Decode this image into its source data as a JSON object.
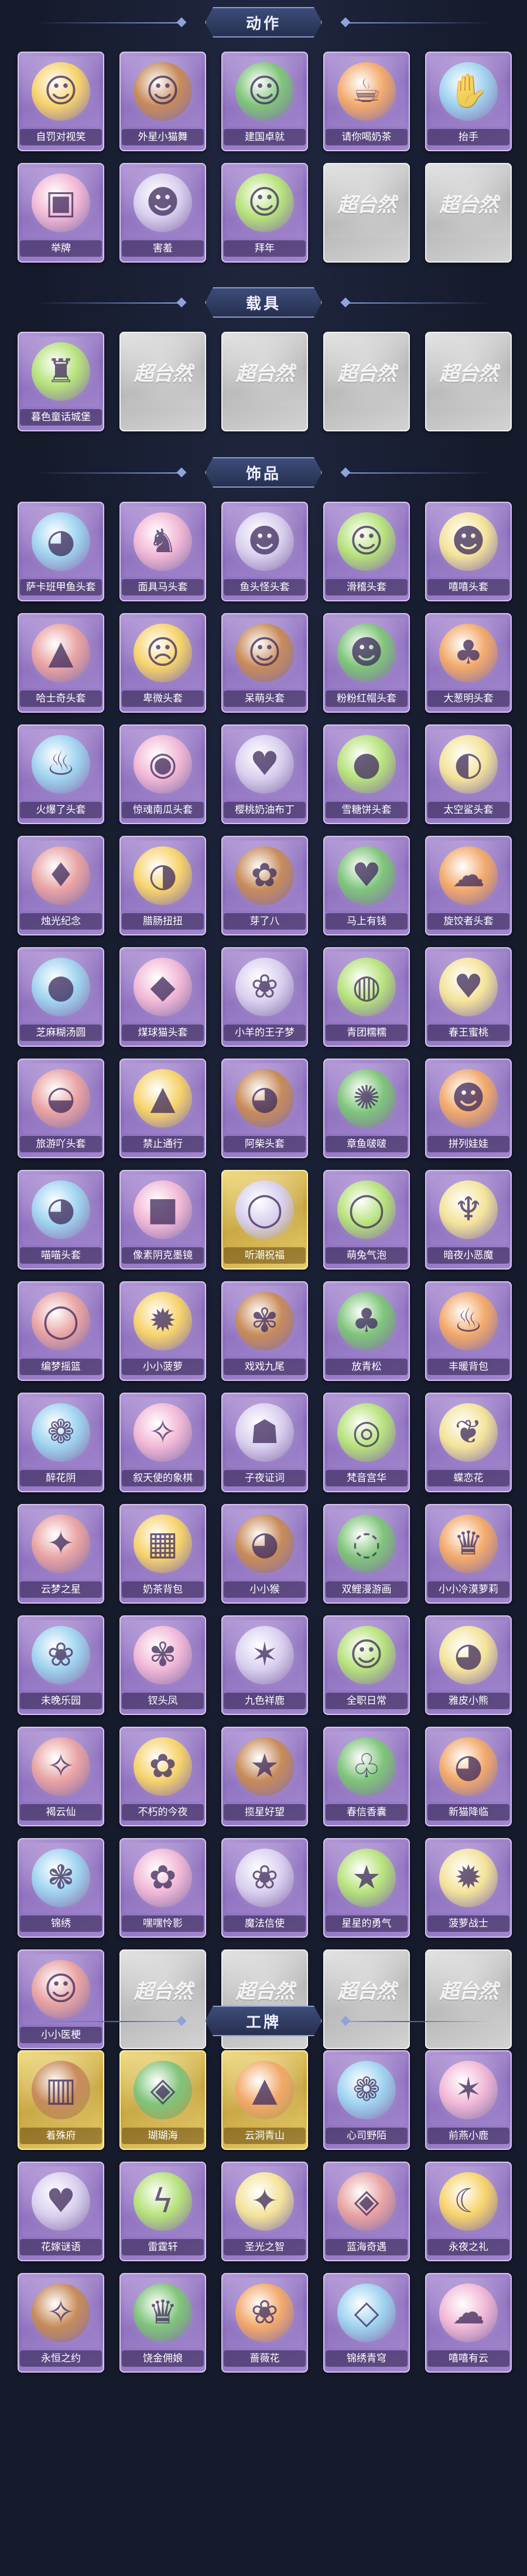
{
  "placeholder_logo": "超台然",
  "sections": [
    {
      "id": "actions",
      "title": "动作",
      "items": [
        {
          "label": "自罚对视笑",
          "icon": "dance-figure-icon",
          "tone": "purple"
        },
        {
          "label": "外星小猫舞",
          "icon": "dance-figure-icon",
          "tone": "purple"
        },
        {
          "label": "建国卓就",
          "icon": "dance-figure-icon",
          "tone": "purple"
        },
        {
          "label": "请你喝奶茶",
          "icon": "milk-tea-icon",
          "tone": "purple"
        },
        {
          "label": "抬手",
          "icon": "raise-hand-icon",
          "tone": "purple"
        },
        {
          "label": "举牌",
          "icon": "sign-board-icon",
          "tone": "purple"
        },
        {
          "label": "害羞",
          "icon": "shy-figure-icon",
          "tone": "purple"
        },
        {
          "label": "拜年",
          "icon": "bow-figure-icon",
          "tone": "purple"
        },
        {
          "label": "",
          "icon": "placeholder-logo-icon",
          "tone": "empty"
        },
        {
          "label": "",
          "icon": "placeholder-logo-icon",
          "tone": "empty"
        }
      ]
    },
    {
      "id": "vehicles",
      "title": "载具",
      "items": [
        {
          "label": "暮色童话城堡",
          "icon": "castle-icon",
          "tone": "purple"
        },
        {
          "label": "",
          "icon": "placeholder-logo-icon",
          "tone": "empty"
        },
        {
          "label": "",
          "icon": "placeholder-logo-icon",
          "tone": "empty"
        },
        {
          "label": "",
          "icon": "placeholder-logo-icon",
          "tone": "empty"
        },
        {
          "label": "",
          "icon": "placeholder-logo-icon",
          "tone": "empty"
        }
      ]
    },
    {
      "id": "accessories",
      "title": "饰品",
      "items": [
        {
          "label": "萨卡班甲鱼头套",
          "icon": "fish-head-icon",
          "tone": "purple"
        },
        {
          "label": "面具马头套",
          "icon": "horse-head-icon",
          "tone": "purple"
        },
        {
          "label": "鱼头怪头套",
          "icon": "fish-monster-icon",
          "tone": "purple"
        },
        {
          "label": "滑稽头套",
          "icon": "smirk-face-icon",
          "tone": "purple"
        },
        {
          "label": "嘻嘻头套",
          "icon": "grin-face-icon",
          "tone": "purple"
        },
        {
          "label": "哈士奇头套",
          "icon": "husky-head-icon",
          "tone": "purple"
        },
        {
          "label": "卑微头套",
          "icon": "pleading-face-icon",
          "tone": "purple"
        },
        {
          "label": "呆萌头套",
          "icon": "silly-face-icon",
          "tone": "purple"
        },
        {
          "label": "粉粉红帽头套",
          "icon": "pikachu-head-icon",
          "tone": "purple"
        },
        {
          "label": "大葱明头套",
          "icon": "scallion-head-icon",
          "tone": "purple"
        },
        {
          "label": "火爆了头套",
          "icon": "fire-spirit-icon",
          "tone": "purple"
        },
        {
          "label": "惊魂南瓜头套",
          "icon": "pumpkin-head-icon",
          "tone": "purple"
        },
        {
          "label": "樱桃奶油布丁",
          "icon": "pudding-icon",
          "tone": "purple"
        },
        {
          "label": "雪糖饼头套",
          "icon": "cookie-pig-icon",
          "tone": "purple"
        },
        {
          "label": "太空鲨头套",
          "icon": "shark-head-icon",
          "tone": "purple"
        },
        {
          "label": "烛光纪念",
          "icon": "candle-icon",
          "tone": "purple"
        },
        {
          "label": "腊肠扭扭",
          "icon": "dachshund-icon",
          "tone": "purple"
        },
        {
          "label": "芽了八",
          "icon": "sprout-icon",
          "tone": "purple"
        },
        {
          "label": "马上有钱",
          "icon": "money-horse-icon",
          "tone": "purple"
        },
        {
          "label": "旋饺者头套",
          "icon": "cloud-head-icon",
          "tone": "purple"
        },
        {
          "label": "芝麻糊汤圆",
          "icon": "dumpling-icon",
          "tone": "purple"
        },
        {
          "label": "煤球猫头套",
          "icon": "black-cat-icon",
          "tone": "purple"
        },
        {
          "label": "小羊的王子梦",
          "icon": "sheep-icon",
          "tone": "purple"
        },
        {
          "label": "青团糯糯",
          "icon": "green-bun-icon",
          "tone": "purple"
        },
        {
          "label": "春王蜜桃",
          "icon": "peach-icon",
          "tone": "purple"
        },
        {
          "label": "旅游吖头套",
          "icon": "bird-hat-icon",
          "tone": "purple"
        },
        {
          "label": "禁止通行",
          "icon": "barrier-icon",
          "tone": "purple"
        },
        {
          "label": "阿柴头套",
          "icon": "shiba-icon",
          "tone": "purple"
        },
        {
          "label": "章鱼啵啵",
          "icon": "octopus-icon",
          "tone": "purple"
        },
        {
          "label": "拼列娃娃",
          "icon": "doll-icon",
          "tone": "purple"
        },
        {
          "label": "喵喵头套",
          "icon": "cat-head-icon",
          "tone": "purple"
        },
        {
          "label": "像素阴克墨镜",
          "icon": "sunglasses-icon",
          "tone": "purple"
        },
        {
          "label": "听潮祝福",
          "icon": "silhouette-icon",
          "tone": "gold"
        },
        {
          "label": "萌兔气泡",
          "icon": "silhouette-icon",
          "tone": "purple"
        },
        {
          "label": "暗夜小恶魔",
          "icon": "devil-horns-icon",
          "tone": "purple"
        },
        {
          "label": "编梦摇篮",
          "icon": "silhouette-icon",
          "tone": "purple"
        },
        {
          "label": "小小菠萝",
          "icon": "pineapple-icon",
          "tone": "purple"
        },
        {
          "label": "戏戏九尾",
          "icon": "fox-icon",
          "tone": "purple"
        },
        {
          "label": "放青松",
          "icon": "pine-tree-icon",
          "tone": "purple"
        },
        {
          "label": "丰暖背包",
          "icon": "cake-backpack-icon",
          "tone": "purple"
        },
        {
          "label": "醉花阴",
          "icon": "flower-girl-icon",
          "tone": "purple"
        },
        {
          "label": "叙天使的象棋",
          "icon": "angel-girl-icon",
          "tone": "purple"
        },
        {
          "label": "子夜证词",
          "icon": "detective-icon",
          "tone": "purple"
        },
        {
          "label": "梵音宫华",
          "icon": "lantern-icon",
          "tone": "purple"
        },
        {
          "label": "蝶恋花",
          "icon": "butterfly-girl-icon",
          "tone": "purple"
        },
        {
          "label": "云梦之星",
          "icon": "unicorn-icon",
          "tone": "purple"
        },
        {
          "label": "奶茶背包",
          "icon": "qr-bag-icon",
          "tone": "purple"
        },
        {
          "label": "小小猴",
          "icon": "monkey-icon",
          "tone": "purple"
        },
        {
          "label": "双鲤漫游画",
          "icon": "koi-icon",
          "tone": "purple"
        },
        {
          "label": "小小冷漠萝莉",
          "icon": "gothic-girl-icon",
          "tone": "purple"
        },
        {
          "label": "未晚乐园",
          "icon": "pink-girl-icon",
          "tone": "purple"
        },
        {
          "label": "钗头凤",
          "icon": "phoenix-girl-icon",
          "tone": "purple"
        },
        {
          "label": "九色祥鹿",
          "icon": "deer-icon",
          "tone": "purple"
        },
        {
          "label": "全职日常",
          "icon": "office-boy-icon",
          "tone": "purple"
        },
        {
          "label": "雅皮小熊",
          "icon": "bear-charm-icon",
          "tone": "purple"
        },
        {
          "label": "褐云仙",
          "icon": "fairy-charm-icon",
          "tone": "purple"
        },
        {
          "label": "不朽的今夜",
          "icon": "flower-charm-icon",
          "tone": "purple"
        },
        {
          "label": "揽星好望",
          "icon": "star-charm-icon",
          "tone": "purple"
        },
        {
          "label": "春信香囊",
          "icon": "pouch-charm-icon",
          "tone": "purple"
        },
        {
          "label": "新猫降临",
          "icon": "cat-charm-icon",
          "tone": "purple"
        },
        {
          "label": "锦绣",
          "icon": "embroidery-charm-icon",
          "tone": "purple"
        },
        {
          "label": "嘿嘿怜影",
          "icon": "cat-girl-charm-icon",
          "tone": "purple"
        },
        {
          "label": "魔法信使",
          "icon": "bunny-charm-icon",
          "tone": "purple"
        },
        {
          "label": "星星的勇气",
          "icon": "star-bear-charm-icon",
          "tone": "purple"
        },
        {
          "label": "菠萝战士",
          "icon": "pineapple-warrior-icon",
          "tone": "purple"
        },
        {
          "label": "小小医梗",
          "icon": "doctor-girl-icon",
          "tone": "purple"
        },
        {
          "label": "",
          "icon": "placeholder-logo-icon",
          "tone": "empty"
        },
        {
          "label": "",
          "icon": "placeholder-logo-icon",
          "tone": "empty"
        },
        {
          "label": "",
          "icon": "placeholder-logo-icon",
          "tone": "empty"
        },
        {
          "label": "",
          "icon": "placeholder-logo-icon",
          "tone": "empty"
        }
      ]
    },
    {
      "id": "badges",
      "title": "工牌",
      "items": [
        {
          "label": "着殊府",
          "icon": "book-card-icon",
          "tone": "gold"
        },
        {
          "label": "瑚瑚海",
          "icon": "ocean-card-icon",
          "tone": "gold"
        },
        {
          "label": "云洞青山",
          "icon": "mountain-card-icon",
          "tone": "gold"
        },
        {
          "label": "心司野陌",
          "icon": "field-card-icon",
          "tone": "purple"
        },
        {
          "label": "前燕小鹿",
          "icon": "deer-card-icon",
          "tone": "purple"
        },
        {
          "label": "花嫁谜语",
          "icon": "bride-card-icon",
          "tone": "purple"
        },
        {
          "label": "雷霆轩",
          "icon": "thunder-card-icon",
          "tone": "purple"
        },
        {
          "label": "圣光之智",
          "icon": "holy-card-icon",
          "tone": "purple"
        },
        {
          "label": "蓝海奇遇",
          "icon": "sea-card-icon",
          "tone": "purple"
        },
        {
          "label": "永夜之礼",
          "icon": "night-card-icon",
          "tone": "purple"
        },
        {
          "label": "永恒之约",
          "icon": "eternal-card-icon",
          "tone": "purple"
        },
        {
          "label": "饶金佣娘",
          "icon": "gold-lady-card-icon",
          "tone": "purple"
        },
        {
          "label": "蔷薇花",
          "icon": "rose-card-icon",
          "tone": "purple"
        },
        {
          "label": "锦绣青穹",
          "icon": "sky-card-icon",
          "tone": "purple"
        },
        {
          "label": "嘻嘻有云",
          "icon": "cloud-card-icon",
          "tone": "purple"
        }
      ]
    }
  ]
}
